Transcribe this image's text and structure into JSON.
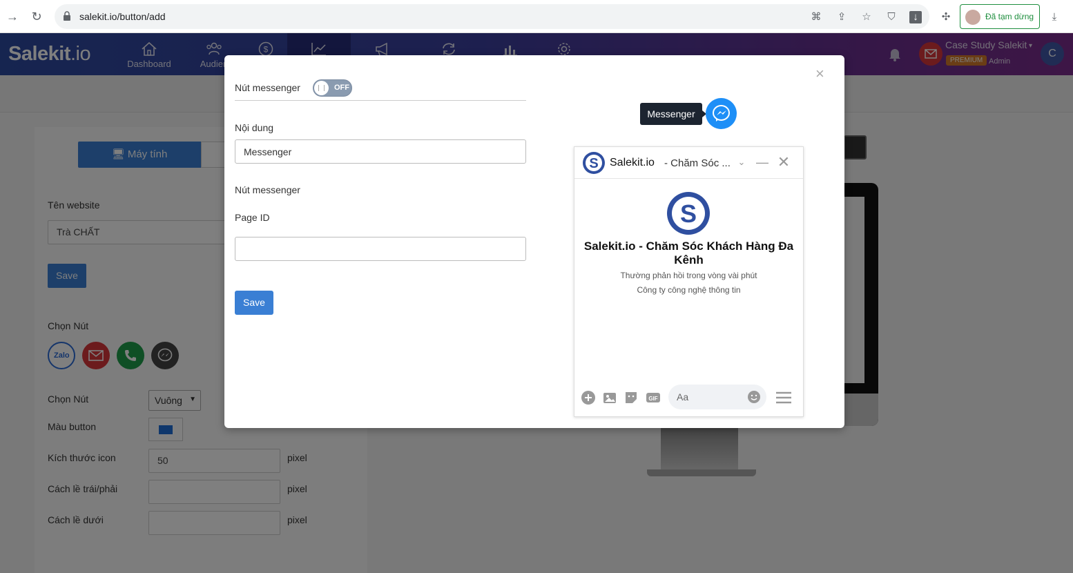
{
  "browser": {
    "url": "salekit.io/button/add",
    "paused_label": "Đã tạm dừng"
  },
  "header": {
    "logo_main": "Salekit",
    "logo_suffix": ".io",
    "nav": [
      {
        "label": "Dashboard"
      },
      {
        "label": "Audien"
      },
      {
        "label": ""
      },
      {
        "label": ""
      },
      {
        "label": ""
      },
      {
        "label": ""
      },
      {
        "label": ""
      },
      {
        "label": ""
      }
    ],
    "user_name": "Case Study Salekit",
    "badge": "PREMIUM",
    "role": "Admin",
    "avatar_letter": "C"
  },
  "background_form": {
    "tab_computer": "Máy tính",
    "website_label": "Tên website",
    "website_value": "Trà CHẤT",
    "save_label": "Save",
    "choose_button_label": "Chọn Nút",
    "icons": [
      "zalo-icon",
      "mail-icon",
      "phone-icon",
      "messenger-icon"
    ],
    "icon_colors": [
      "#ffffff",
      "#d9373a",
      "#1e9e4a",
      "#444444"
    ],
    "shape_label": "Chọn Nút",
    "shape_value": "Vuông",
    "color_label": "Màu button",
    "color_value": "#1e6fd9",
    "icon_size_label": "Kích thước icon",
    "icon_size_value": "50",
    "margin_lr_label": "Cách lề trái/phải",
    "margin_lr_value": "",
    "margin_bottom_label": "Cách lề dưới",
    "margin_bottom_value": "",
    "unit": "pixel"
  },
  "modal": {
    "toggle_label": "Nút messenger",
    "toggle_state": "OFF",
    "content_label": "Nội dung",
    "content_value": "Messenger",
    "section_label": "Nút messenger",
    "page_id_label": "Page ID",
    "page_id_value": "",
    "save_label": "Save",
    "close_symbol": "×"
  },
  "preview": {
    "tooltip": "Messenger",
    "chat_title": "Salekit.io",
    "chat_subtitle": "- Chăm Sóc ...",
    "page_name": "Salekit.io - Chăm Sóc Khách Hàng Đa Kênh",
    "response_time": "Thường phản hồi trong vòng vài phút",
    "category": "Công ty công nghệ thông tin",
    "input_placeholder": "Aa"
  }
}
